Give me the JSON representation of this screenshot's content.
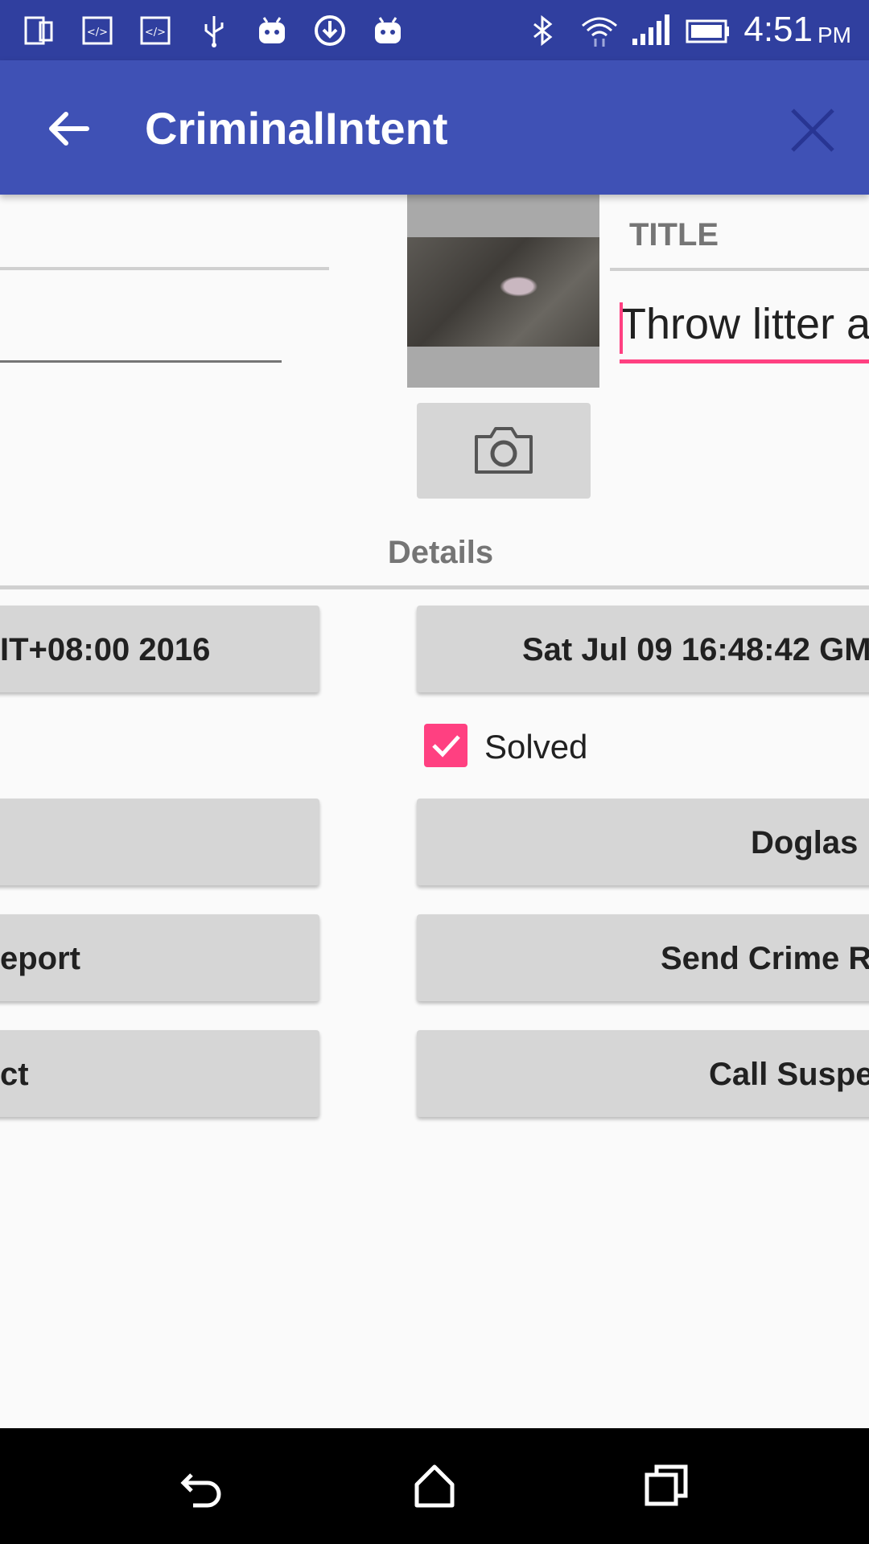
{
  "status_bar": {
    "time": "4:51",
    "ampm": "PM",
    "icons": [
      "phone-icon",
      "code-icon",
      "code-icon",
      "usb-icon",
      "android-icon",
      "download-icon",
      "android-icon",
      "bluetooth-icon",
      "wifi-icon",
      "signal-icon",
      "battery-icon"
    ]
  },
  "toolbar": {
    "title": "CriminalIntent",
    "back_icon": "arrow-back-icon",
    "close_icon": "close-icon"
  },
  "crime": {
    "title_label": "TITLE",
    "title_value": "Throw litter a",
    "details_label": "Details",
    "date_left": "IT+08:00 2016",
    "date_right": "Sat Jul 09 16:48:42 GM",
    "solved_label": "Solved",
    "solved": true,
    "suspect_left": "",
    "suspect_right": "Doglas",
    "report_left": "eport",
    "report_right": "Send Crime Re",
    "call_left": "ct",
    "call_right": "Call Suspe"
  },
  "colors": {
    "status_bar": "#303f9f",
    "toolbar": "#3f51b5",
    "accent": "#ff4081",
    "button": "#d6d6d6"
  }
}
